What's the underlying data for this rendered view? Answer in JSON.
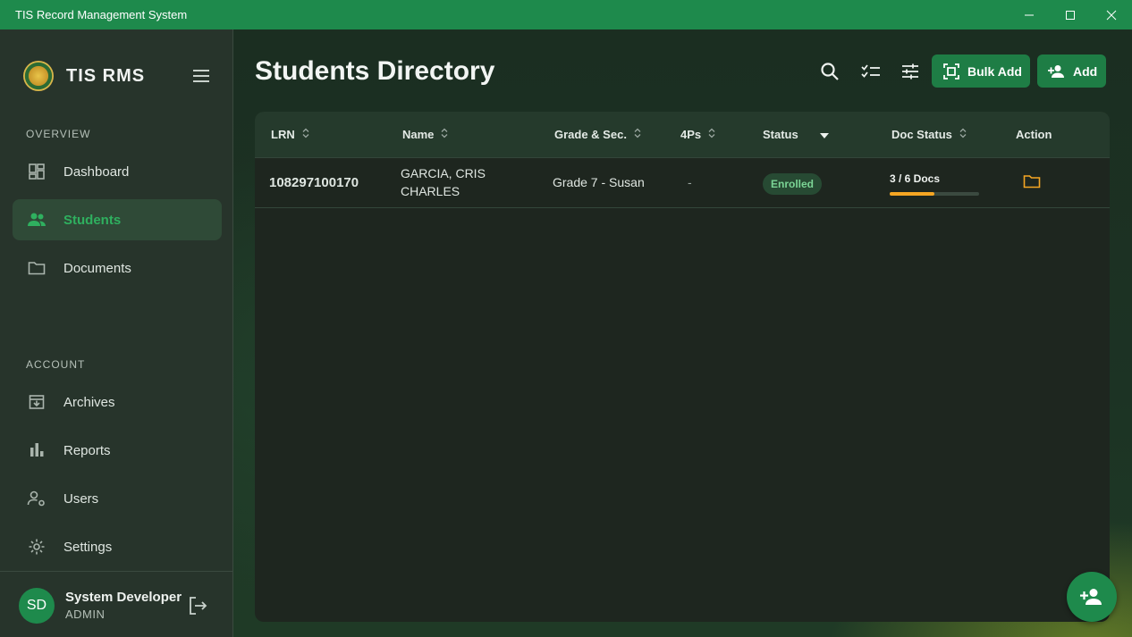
{
  "window": {
    "title": "TIS Record Management System"
  },
  "brand": {
    "name": "TIS RMS"
  },
  "sidebar": {
    "overview_label": "OVERVIEW",
    "account_label": "ACCOUNT",
    "overview_items": [
      {
        "label": "Dashboard",
        "icon": "dashboard-icon"
      },
      {
        "label": "Students",
        "icon": "students-icon",
        "active": true
      },
      {
        "label": "Documents",
        "icon": "folder-icon"
      }
    ],
    "account_items": [
      {
        "label": "Archives",
        "icon": "archive-icon"
      },
      {
        "label": "Reports",
        "icon": "bar-chart-icon"
      },
      {
        "label": "Users",
        "icon": "user-settings-icon"
      },
      {
        "label": "Settings",
        "icon": "gear-icon"
      }
    ],
    "user": {
      "initials": "SD",
      "name": "System Developer",
      "role": "ADMIN"
    }
  },
  "header": {
    "title": "Students Directory",
    "bulk_add_label": "Bulk Add",
    "add_label": "Add"
  },
  "table": {
    "columns": [
      "LRN",
      "Name",
      "Grade & Sec.",
      "4Ps",
      "Status",
      "Doc Status",
      "Action"
    ],
    "rows": [
      {
        "lrn": "108297100170",
        "name_line1": "GARCIA, CRIS",
        "name_line2": "CHARLES",
        "grade_section": "Grade 7 - Susan",
        "four_ps": "-",
        "status": "Enrolled",
        "doc_status": "3 / 6 Docs",
        "doc_progress": 0.5
      }
    ]
  },
  "colors": {
    "accent": "#1e8a4c",
    "progress": "#f5a623",
    "status_enrolled": "#7bd495"
  }
}
